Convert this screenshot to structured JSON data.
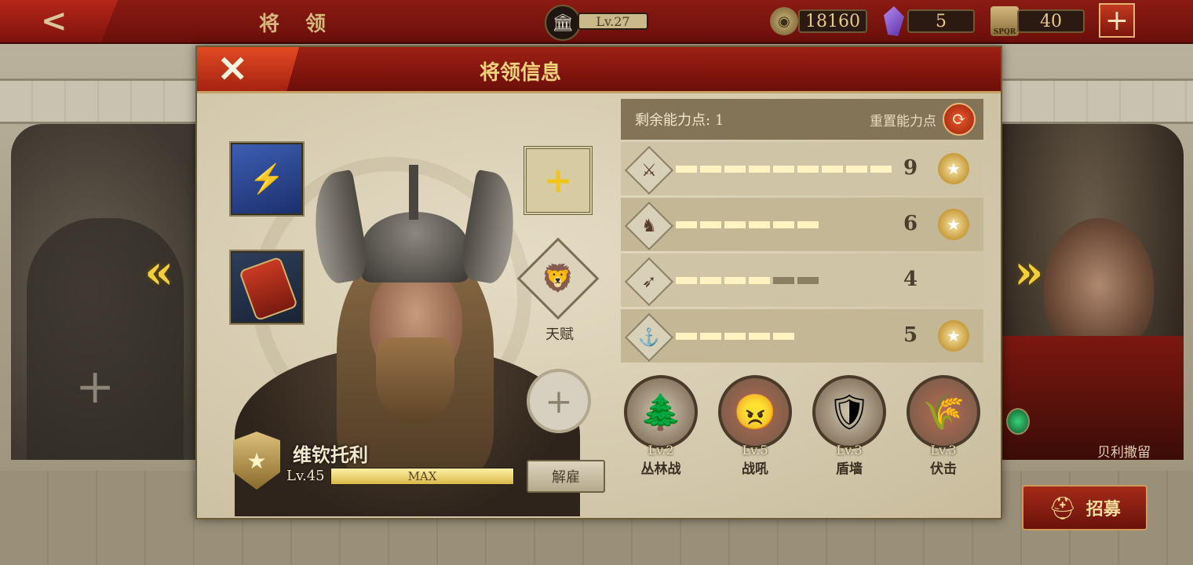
{
  "topbar": {
    "back_glyph": "<",
    "title": "将 领",
    "level": "Lv.27",
    "gold": "18160",
    "gems": "5",
    "tokens": "40",
    "add_glyph": "+",
    "token_badge": "SPQR"
  },
  "modal": {
    "title": "将领信息",
    "close_glyph": "✕"
  },
  "general": {
    "name": "维钦托利",
    "level": "Lv.45",
    "exp_label": "MAX",
    "exp_fraction": 1.0,
    "dismiss_label": "解雇",
    "talent_label": "天赋"
  },
  "stats": {
    "remaining_label": "剩余能力点:",
    "remaining_value": "1",
    "reset_label": "重置能力点",
    "rows": [
      {
        "icon": "sword-icon",
        "glyph": "⚔",
        "value": 9,
        "max": 9,
        "laurel": true
      },
      {
        "icon": "cavalry-icon",
        "glyph": "♞",
        "value": 6,
        "max": 6,
        "laurel": true
      },
      {
        "icon": "bow-icon",
        "glyph": "➶",
        "value": 4,
        "max": 6,
        "laurel": false
      },
      {
        "icon": "anchor-icon",
        "glyph": "⚓",
        "value": 5,
        "max": 5,
        "laurel": true
      }
    ]
  },
  "skills": [
    {
      "icon": "forest-icon",
      "glyph": "🌲",
      "level": "Lv.2",
      "name": "丛林战"
    },
    {
      "icon": "warcry-icon",
      "glyph": "😠",
      "level": "Lv.5",
      "name": "战吼"
    },
    {
      "icon": "shield-wall-icon",
      "glyph": "🛡",
      "level": "Lv.3",
      "name": "盾墙"
    },
    {
      "icon": "ambush-icon",
      "glyph": "🌾",
      "level": "Lv.3",
      "name": "伏击"
    }
  ],
  "side": {
    "left_arrow": "«",
    "right_arrow": "»",
    "right_name": "贝利撒留",
    "left_add": "+"
  },
  "recruit": {
    "label": "招募"
  },
  "colors": {
    "accent_red": "#8a1b13",
    "gold_text": "#f3d27a",
    "bar_fill": "#fff3c2"
  }
}
